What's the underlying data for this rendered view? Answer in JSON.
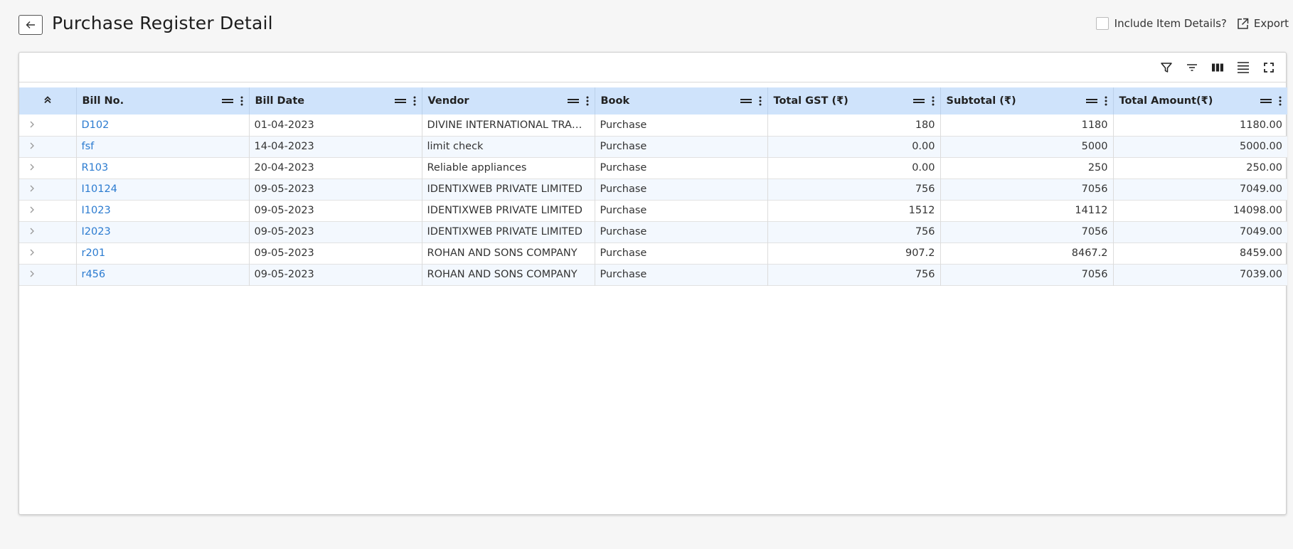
{
  "header": {
    "title": "Purchase Register Detail",
    "include_label": "Include Item Details?",
    "export_label": "Export"
  },
  "toolbar": {
    "icons": [
      "filter-icon",
      "sort-icon",
      "columns-icon",
      "density-icon",
      "fullscreen-icon"
    ]
  },
  "table": {
    "columns": [
      "Bill No.",
      "Bill Date",
      "Vendor",
      "Book",
      "Total GST (₹)",
      "Subtotal (₹)",
      "Total Amount(₹)"
    ],
    "rows": [
      {
        "bill_no": "D102",
        "bill_date": "01-04-2023",
        "vendor": "DIVINE INTERNATIONAL TRADING",
        "book": "Purchase",
        "total_gst": "180",
        "subtotal": "1180",
        "total_amount": "1180.00"
      },
      {
        "bill_no": "fsf",
        "bill_date": "14-04-2023",
        "vendor": "limit check",
        "book": "Purchase",
        "total_gst": "0.00",
        "subtotal": "5000",
        "total_amount": "5000.00"
      },
      {
        "bill_no": "R103",
        "bill_date": "20-04-2023",
        "vendor": "Reliable appliances",
        "book": "Purchase",
        "total_gst": "0.00",
        "subtotal": "250",
        "total_amount": "250.00"
      },
      {
        "bill_no": "I10124",
        "bill_date": "09-05-2023",
        "vendor": "IDENTIXWEB PRIVATE LIMITED",
        "book": "Purchase",
        "total_gst": "756",
        "subtotal": "7056",
        "total_amount": "7049.00"
      },
      {
        "bill_no": "I1023",
        "bill_date": "09-05-2023",
        "vendor": "IDENTIXWEB PRIVATE LIMITED",
        "book": "Purchase",
        "total_gst": "1512",
        "subtotal": "14112",
        "total_amount": "14098.00"
      },
      {
        "bill_no": "I2023",
        "bill_date": "09-05-2023",
        "vendor": "IDENTIXWEB PRIVATE LIMITED",
        "book": "Purchase",
        "total_gst": "756",
        "subtotal": "7056",
        "total_amount": "7049.00"
      },
      {
        "bill_no": "r201",
        "bill_date": "09-05-2023",
        "vendor": "ROHAN AND SONS COMPANY",
        "book": "Purchase",
        "total_gst": "907.2",
        "subtotal": "8467.2",
        "total_amount": "8459.00"
      },
      {
        "bill_no": "r456",
        "bill_date": "09-05-2023",
        "vendor": "ROHAN AND SONS COMPANY",
        "book": "Purchase",
        "total_gst": "756",
        "subtotal": "7056",
        "total_amount": "7039.00"
      }
    ]
  },
  "colors": {
    "header_bg": "#cfe3fb",
    "link": "#2b7bd0",
    "stripe": "#f3f8fe"
  }
}
